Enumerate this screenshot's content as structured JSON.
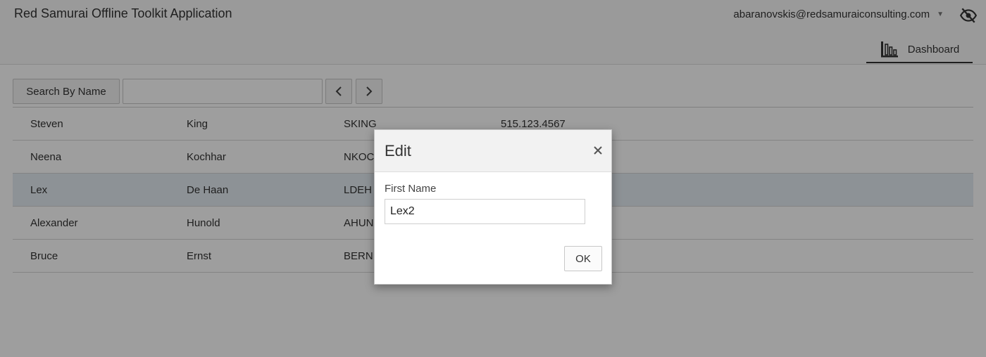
{
  "app": {
    "title": "Red Samurai Offline Toolkit Application"
  },
  "user": {
    "email": "abaranovskis@redsamuraiconsulting.com"
  },
  "nav": {
    "tabs": [
      {
        "label": "Dashboard",
        "icon": "bar-chart-icon",
        "active": true
      }
    ]
  },
  "toolbar": {
    "search_button_label": "Search By Name",
    "search_value": "",
    "prev_icon": "chevron-left-icon",
    "next_icon": "chevron-right-icon"
  },
  "table": {
    "rows": [
      {
        "first": "Steven",
        "last": "King",
        "email": "SKING",
        "phone": "515.123.4567"
      },
      {
        "first": "Neena",
        "last": "Kochhar",
        "email": "NKOC",
        "phone": ""
      },
      {
        "first": "Lex",
        "last": "De Haan",
        "email": "LDEH",
        "phone": "",
        "selected": true
      },
      {
        "first": "Alexander",
        "last": "Hunold",
        "email": "AHUN",
        "phone": ""
      },
      {
        "first": "Bruce",
        "last": "Ernst",
        "email": "BERN",
        "phone": ""
      }
    ]
  },
  "dialog": {
    "title": "Edit",
    "field_label": "First Name",
    "field_value": "Lex2",
    "ok_label": "OK"
  },
  "colors": {
    "selected_row": "#e4ecf2",
    "overlay": "rgba(0,0,0,0.38)"
  }
}
